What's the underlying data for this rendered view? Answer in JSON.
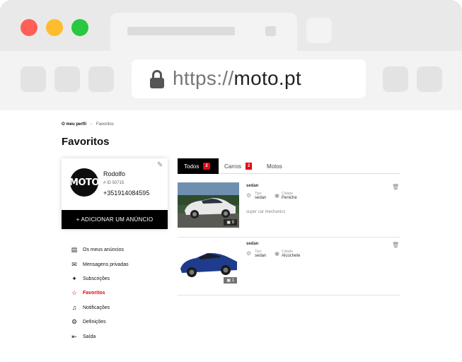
{
  "browser": {
    "url_scheme": "https://",
    "url_host": "moto.pt",
    "colors": {
      "close": "#fe5f57",
      "minimize": "#febc2e",
      "maximize": "#28c840"
    }
  },
  "breadcrumb": {
    "home": "O meu perfil",
    "current": "Favoritos"
  },
  "page_title": "Favoritos",
  "profile": {
    "avatar_text": "MOTO",
    "name": "Rodolfo",
    "id": "# ID 50715",
    "phone": "+351914084595",
    "add_button": "+ ADICIONAR UM ANÚNCIO"
  },
  "menu": {
    "items": [
      {
        "label": "Os meus anúncios",
        "icon": "clipboard-icon"
      },
      {
        "label": "Mensagens privadas",
        "icon": "chat-icon"
      },
      {
        "label": "Subscrições",
        "icon": "pin-icon"
      },
      {
        "label": "Favoritos",
        "icon": "star-icon"
      },
      {
        "label": "Notificações",
        "icon": "bell-icon"
      },
      {
        "label": "Definições",
        "icon": "gear-icon"
      },
      {
        "label": "Saída",
        "icon": "logout-icon"
      }
    ]
  },
  "tabs": [
    {
      "label": "Todos",
      "count": "2"
    },
    {
      "label": "Carros",
      "count": "2"
    },
    {
      "label": "Motos",
      "count": ""
    }
  ],
  "listings": [
    {
      "name": "sedan",
      "type_label": "Tipo",
      "type_value": "sedan",
      "city_label": "Cidade",
      "city_value": "Peniche",
      "description": "super car mechanics",
      "photos": "9",
      "car_color": "#e8e8e8"
    },
    {
      "name": "sedan",
      "type_label": "Tipo",
      "type_value": "sedan",
      "city_label": "Cidade",
      "city_value": "Alcochete",
      "description": "",
      "photos": "1",
      "car_color": "#1f3c8c"
    }
  ]
}
